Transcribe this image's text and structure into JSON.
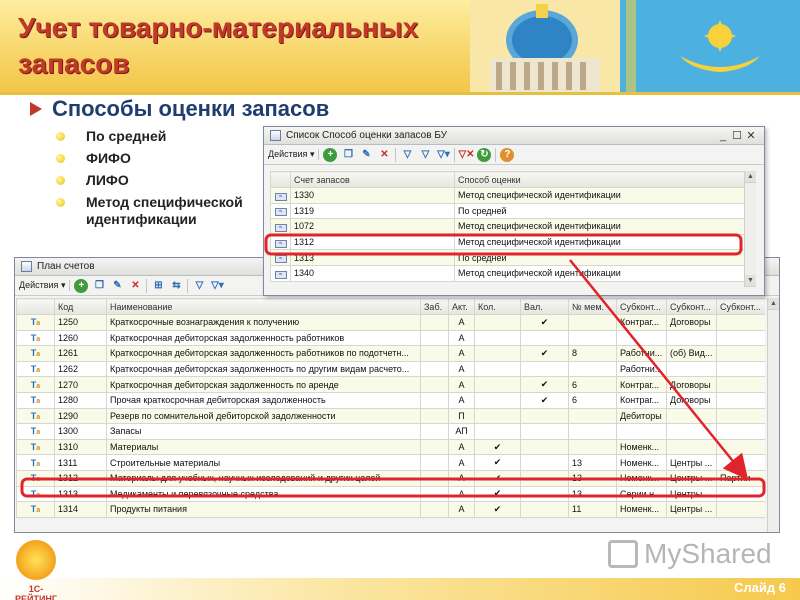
{
  "slide": {
    "title": "Учет товарно-материальных запасов",
    "subtitle": "Способы оценки запасов",
    "bullets": [
      "По средней",
      "ФИФО",
      "ЛИФО",
      "Метод специфической идентификации"
    ],
    "slide_number": "Слайд 6",
    "logo_text": "1С-РЕЙТИНГ",
    "watermark": "MyShared"
  },
  "colors": {
    "title": "#c0392b",
    "subtitle": "#1f3d6e",
    "highlight": "#e0242b",
    "header_gold": "#f7d568"
  },
  "window_methods": {
    "title": "Список Способ оценки запасов БУ",
    "toolbar": {
      "actions_label": "Действия"
    },
    "columns": [
      "Счет запасов",
      "Способ оценки"
    ],
    "rows": [
      {
        "account": "1330",
        "method": "Метод специфической идентификации"
      },
      {
        "account": "1319",
        "method": "По средней"
      },
      {
        "account": "1072",
        "method": "Метод специфической идентификации"
      },
      {
        "account": "1312",
        "method": "Метод специфической идентификации"
      },
      {
        "account": "1313",
        "method": "По средней"
      },
      {
        "account": "1340",
        "method": "Метод специфической идентификации"
      }
    ],
    "highlighted_account": "1312"
  },
  "window_accounts": {
    "title": "План счетов",
    "toolbar": {
      "actions_label": "Действия"
    },
    "columns": [
      "Код",
      "Наименование",
      "Заб.",
      "Акт.",
      "Кол.",
      "Вал.",
      "№ мем.",
      "Субконт...",
      "Субконт...",
      "Субконт..."
    ],
    "rows": [
      {
        "code": "1250",
        "name": "Краткосрочные вознаграждения к получению",
        "zab": "",
        "akt": "А",
        "kol": "",
        "val": "✔",
        "mem": "",
        "s1": "Контраг...",
        "s2": "Договоры",
        "s3": ""
      },
      {
        "code": "1260",
        "name": "Краткосрочная дебиторская задолженность работников",
        "zab": "",
        "akt": "А",
        "kol": "",
        "val": "",
        "mem": "",
        "s1": "",
        "s2": "",
        "s3": ""
      },
      {
        "code": "1261",
        "name": "Краткосрочная дебиторская задолженность работников по подотчетн...",
        "zab": "",
        "akt": "А",
        "kol": "",
        "val": "✔",
        "mem": "8",
        "s1": "Работни...",
        "s2": "(об) Вид...",
        "s3": ""
      },
      {
        "code": "1262",
        "name": "Краткосрочная дебиторская задолженность по другим видам расчето...",
        "zab": "",
        "akt": "А",
        "kol": "",
        "val": "",
        "mem": "",
        "s1": "Работни...",
        "s2": "",
        "s3": ""
      },
      {
        "code": "1270",
        "name": "Краткосрочная дебиторская задолженность по аренде",
        "zab": "",
        "akt": "А",
        "kol": "",
        "val": "✔",
        "mem": "6",
        "s1": "Контраг...",
        "s2": "Договоры",
        "s3": ""
      },
      {
        "code": "1280",
        "name": "Прочая краткосрочная дебиторская задолженность",
        "zab": "",
        "akt": "А",
        "kol": "",
        "val": "✔",
        "mem": "6",
        "s1": "Контраг...",
        "s2": "Договоры",
        "s3": ""
      },
      {
        "code": "1290",
        "name": "Резерв по сомнительной дебиторской задолженности",
        "zab": "",
        "akt": "П",
        "kol": "",
        "val": "",
        "mem": "",
        "s1": "Дебиторы",
        "s2": "",
        "s3": ""
      },
      {
        "code": "1300",
        "name": "Запасы",
        "zab": "",
        "akt": "АП",
        "kol": "",
        "val": "",
        "mem": "",
        "s1": "",
        "s2": "",
        "s3": ""
      },
      {
        "code": "1310",
        "name": "Материалы",
        "zab": "",
        "akt": "А",
        "kol": "✔",
        "val": "",
        "mem": "",
        "s1": "Номенк...",
        "s2": "",
        "s3": ""
      },
      {
        "code": "1311",
        "name": "Строительные материалы",
        "zab": "",
        "akt": "А",
        "kol": "✔",
        "val": "",
        "mem": "13",
        "s1": "Номенк...",
        "s2": "Центры ...",
        "s3": ""
      },
      {
        "code": "1312",
        "name": "Материалы для учебных, научных исследований и других целей",
        "zab": "",
        "akt": "А",
        "kol": "✔",
        "val": "",
        "mem": "13",
        "s1": "Номенк...",
        "s2": "Центры ...",
        "s3": "Партии"
      },
      {
        "code": "1313",
        "name": "Медикаменты и перевязочные средства",
        "zab": "",
        "akt": "А",
        "kol": "✔",
        "val": "",
        "mem": "13",
        "s1": "Серии н...",
        "s2": "Центры ...",
        "s3": ""
      },
      {
        "code": "1314",
        "name": "Продукты питания",
        "zab": "",
        "akt": "А",
        "kol": "✔",
        "val": "",
        "mem": "11",
        "s1": "Номенк...",
        "s2": "Центры ...",
        "s3": ""
      }
    ],
    "highlighted_code": "1312"
  }
}
